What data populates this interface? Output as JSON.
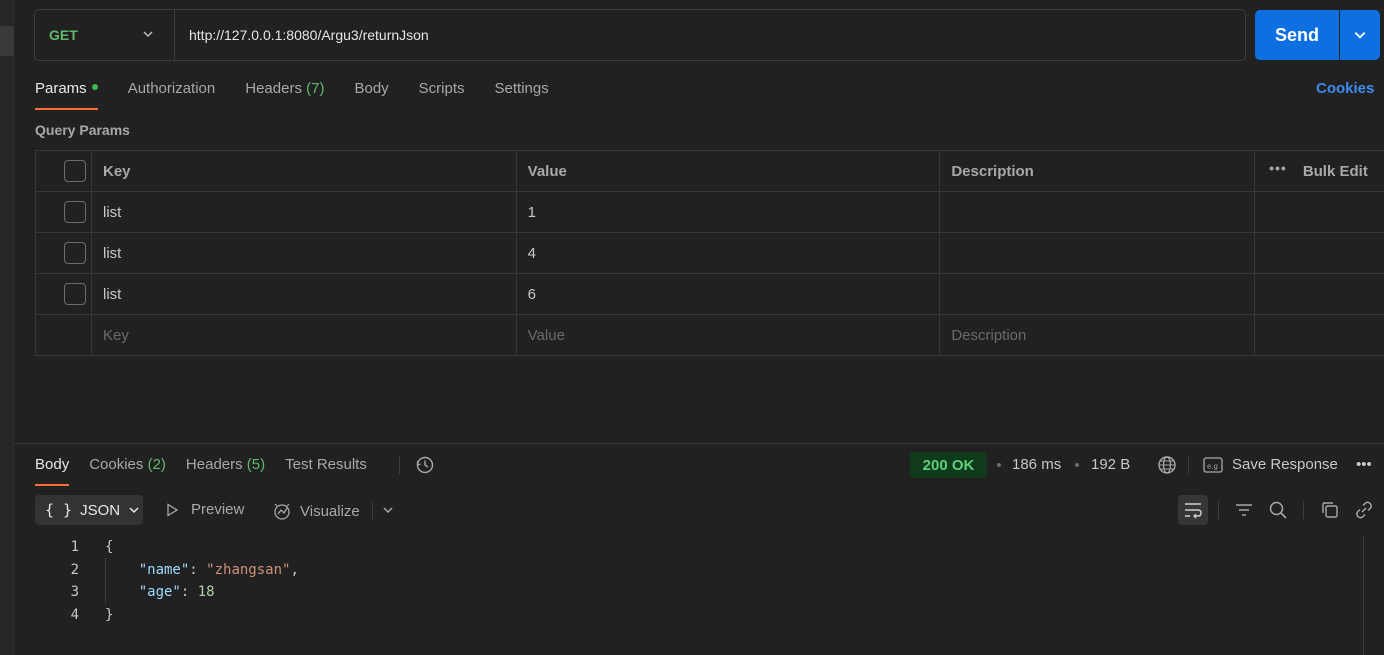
{
  "request": {
    "method": "GET",
    "url": "http://127.0.0.1:8080/Argu3/returnJson",
    "send_label": "Send"
  },
  "request_tabs": [
    {
      "label": "Params",
      "active": true
    },
    {
      "label": "Authorization"
    },
    {
      "label": "Headers",
      "count": "(7)"
    },
    {
      "label": "Body"
    },
    {
      "label": "Scripts"
    },
    {
      "label": "Settings"
    }
  ],
  "cookies_link": "Cookies",
  "query_params": {
    "title": "Query Params",
    "headers": {
      "key": "Key",
      "value": "Value",
      "description": "Description",
      "bulk_edit": "Bulk Edit"
    },
    "rows": [
      {
        "key": "list",
        "value": "1",
        "description": ""
      },
      {
        "key": "list",
        "value": "4",
        "description": ""
      },
      {
        "key": "list",
        "value": "6",
        "description": ""
      }
    ],
    "placeholders": {
      "key": "Key",
      "value": "Value",
      "description": "Description"
    }
  },
  "response": {
    "tabs": [
      {
        "label": "Body",
        "active": true
      },
      {
        "label": "Cookies",
        "count": "(2)"
      },
      {
        "label": "Headers",
        "count": "(5)"
      },
      {
        "label": "Test Results"
      }
    ],
    "status": "200 OK",
    "time": "186 ms",
    "size": "192 B",
    "save_label": "Save Response",
    "format": "JSON",
    "preview_label": "Preview",
    "visualize_label": "Visualize",
    "lines": [
      {
        "num": "1",
        "text": "{"
      },
      {
        "num": "2",
        "key": "\"name\"",
        "sep": ": ",
        "val": "\"zhangsan\"",
        "trail": ","
      },
      {
        "num": "3",
        "key": "\"age\"",
        "sep": ": ",
        "num_val": "18"
      },
      {
        "num": "4",
        "text": "}"
      }
    ]
  },
  "colors": {
    "accent": "#ff6c37",
    "send": "#0d6fe0",
    "method_get": "#5fb96b",
    "status_ok": "#5fd07a"
  },
  "icons": [
    "chevron-down-icon",
    "history-icon",
    "globe-icon",
    "save-response-icon",
    "more-icon",
    "preview-icon",
    "visualize-icon",
    "wrap-lines-icon",
    "filter-icon",
    "search-icon",
    "copy-icon",
    "link-icon"
  ]
}
